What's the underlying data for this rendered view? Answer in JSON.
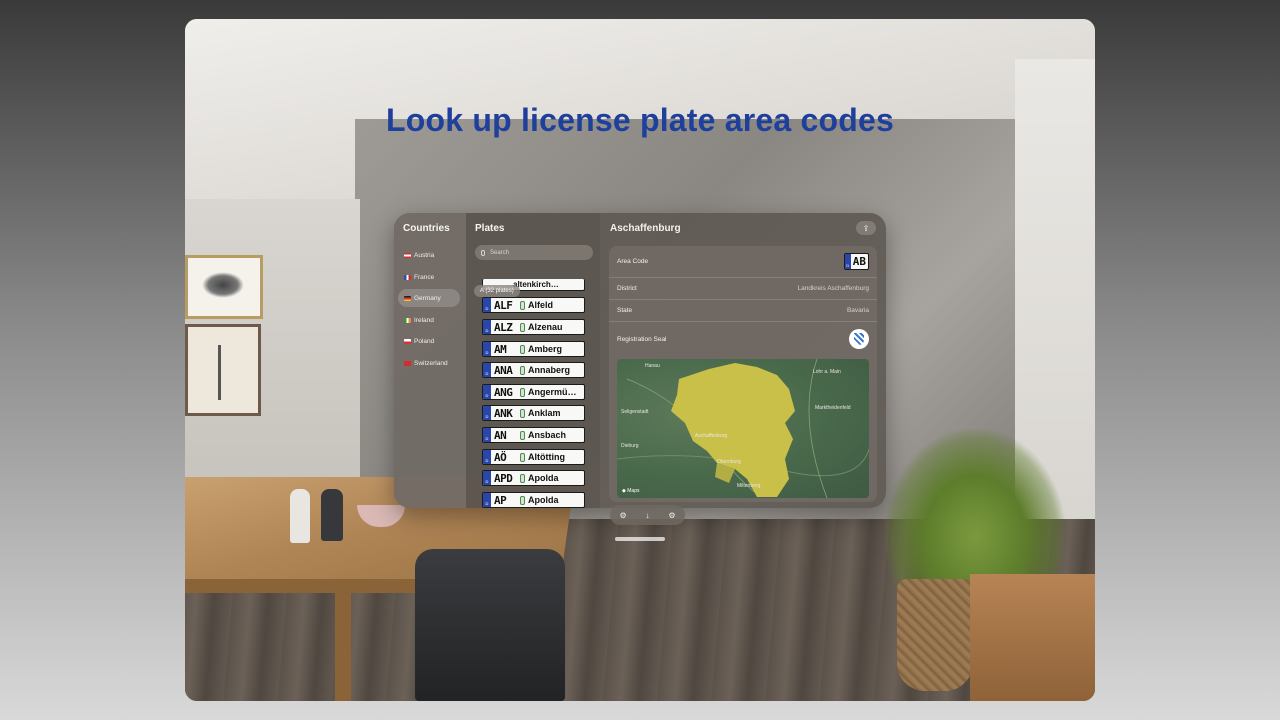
{
  "headline": "Look up license plate area codes",
  "countries": {
    "title": "Countries",
    "items": [
      {
        "label": "Austria",
        "flag_color": "#d72a2a"
      },
      {
        "label": "France",
        "flag_color": "#2a4fb0"
      },
      {
        "label": "Germany",
        "flag_color": "#222222",
        "selected": true
      },
      {
        "label": "Ireland",
        "flag_color": "#2e9a45"
      },
      {
        "label": "Poland",
        "flag_color": "#d8342f"
      },
      {
        "label": "Switzerland",
        "flag_color": "#d72a2a"
      }
    ]
  },
  "plates": {
    "title": "Plates",
    "search_placeholder": "Search",
    "section_label": "A (32 plates)",
    "partial_top": "altenkirch…",
    "items": [
      {
        "code": "ALF",
        "name": "Alfeld"
      },
      {
        "code": "ALZ",
        "name": "Alzenau"
      },
      {
        "code": "AM",
        "name": "Amberg"
      },
      {
        "code": "ANA",
        "name": "Annaberg"
      },
      {
        "code": "ANG",
        "name": "Angermü…"
      },
      {
        "code": "ANK",
        "name": "Anklam"
      },
      {
        "code": "AN",
        "name": "Ansbach"
      },
      {
        "code": "AÖ",
        "name": "Altötting"
      },
      {
        "code": "APD",
        "name": "Apolda"
      },
      {
        "code": "AP",
        "name": "Apolda"
      }
    ]
  },
  "detail": {
    "title": "Aschaffenburg",
    "rows": [
      {
        "label": "Area Code",
        "value": "AB"
      },
      {
        "label": "District",
        "value": "Landkreis Aschaffenburg"
      },
      {
        "label": "State",
        "value": "Bavaria"
      },
      {
        "label": "Registration Seal",
        "value": ""
      }
    ],
    "map_city": "Aschaffenburg",
    "map_places": [
      "Hanau",
      "Lohr a. Main",
      "Marktheidenfeld",
      "Seligenstadt",
      "Obernburg",
      "Miltenberg",
      "Dieburg"
    ],
    "map_credit": "Maps"
  },
  "colors": {
    "headline": "#1e3f9c",
    "plate_eu_band": "#2a46a8",
    "map_district": "#c9c04a"
  },
  "icons": {
    "share": "share-icon",
    "ornament": [
      "gear-icon",
      "download-icon",
      "settings-icon"
    ]
  }
}
